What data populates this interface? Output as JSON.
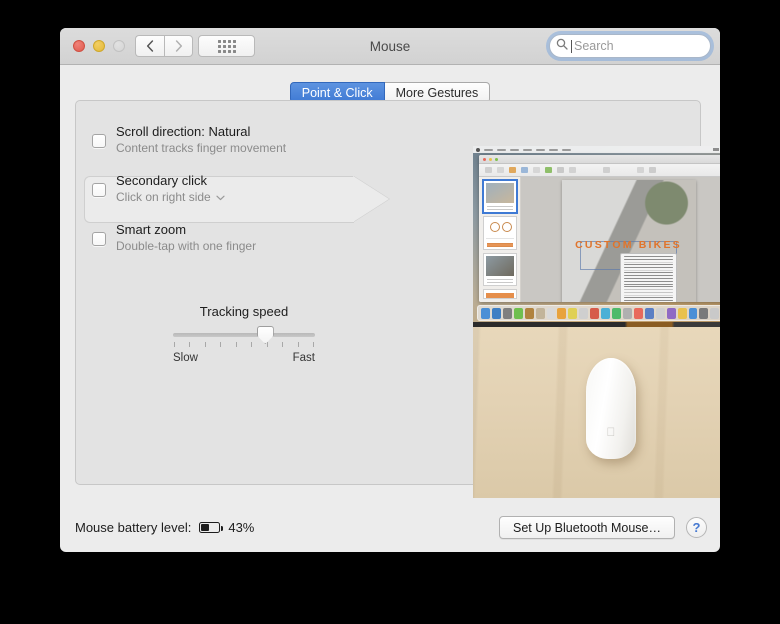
{
  "window": {
    "title": "Mouse",
    "traffic_lights": [
      "close",
      "minimize",
      "zoom"
    ],
    "nav": {
      "back_icon": "chevron-left-icon",
      "forward_icon": "chevron-right-icon"
    },
    "show_all_icon": "grid-dots-icon"
  },
  "search": {
    "icon": "search-icon",
    "placeholder": "Search",
    "value": ""
  },
  "tabs": [
    {
      "label": "Point & Click",
      "active": true
    },
    {
      "label": "More Gestures",
      "active": false
    }
  ],
  "options": [
    {
      "title": "Scroll direction: Natural",
      "subtitle": "Content tracks finger movement",
      "checked": false,
      "has_dropdown": false,
      "selected": false
    },
    {
      "title": "Secondary click",
      "subtitle": "Click on right side",
      "checked": false,
      "has_dropdown": true,
      "dropdown_icon": "chevron-down-icon",
      "selected": true
    },
    {
      "title": "Smart zoom",
      "subtitle": "Double-tap with one finger",
      "checked": false,
      "has_dropdown": false,
      "selected": false
    }
  ],
  "tracking": {
    "label": "Tracking speed",
    "min_label": "Slow",
    "max_label": "Fast",
    "value_percent": 65,
    "tick_count": 10
  },
  "preview": {
    "top": {
      "app_document_title": "CUSTOM BIKES",
      "description": "screenshot of Pages document with bike photo and context menu"
    },
    "bottom": {
      "description": "white Magic Mouse on light wood desk",
      "apple_logo": ""
    }
  },
  "battery": {
    "label": "Mouse battery level:",
    "icon": "battery-icon",
    "percent_text": "43%",
    "percent_value": 43
  },
  "footer": {
    "setup_button": "Set Up Bluetooth Mouse…",
    "help_button": "?",
    "help_icon": "question-mark-icon"
  },
  "colors": {
    "accent_blue": "#3f7ad4",
    "titlebar": "#d6d6d6",
    "window_body": "#ececec",
    "panel": "#e3e3e3",
    "hero_orange": "#e0742c"
  }
}
